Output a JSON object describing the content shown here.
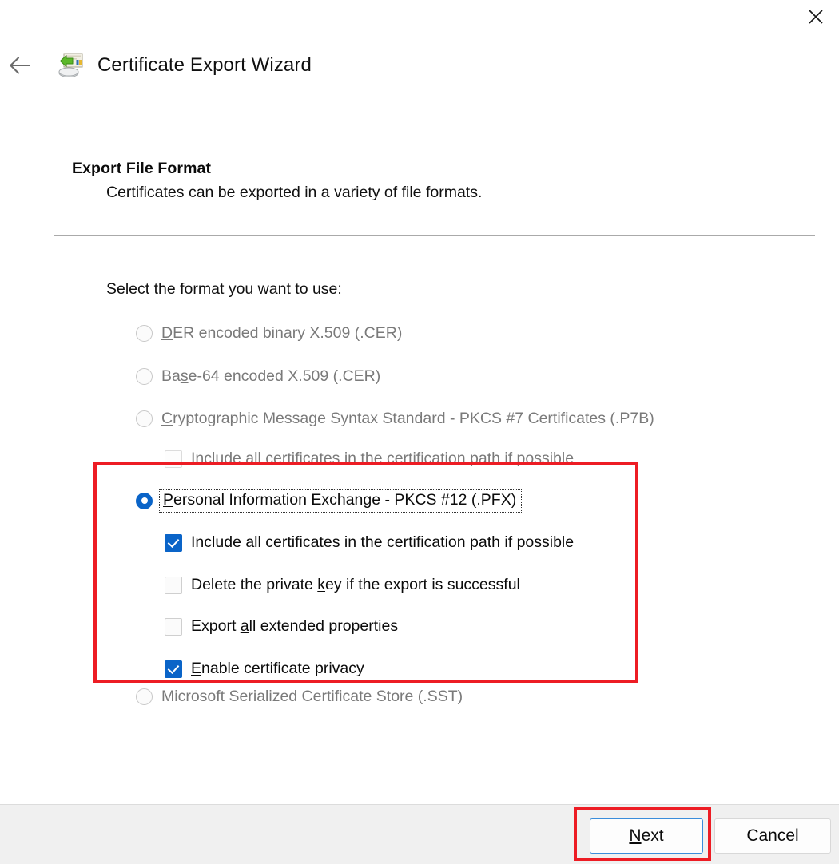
{
  "window": {
    "title": "Certificate Export Wizard",
    "close_label": "✕",
    "back_label": "←",
    "icon_name": "certificate-export-icon"
  },
  "page": {
    "heading": "Export File Format",
    "subheading": "Certificates can be exported in a variety of file formats.",
    "prompt": "Select the format you want to use:"
  },
  "options": [
    {
      "id": "der",
      "control": "radio",
      "label_pre": "D",
      "label_accel": "E",
      "label_post": "R encoded binary X.509 (.CER)",
      "full_label": "DER encoded binary X.509 (.CER)",
      "checked": false,
      "enabled": false
    },
    {
      "id": "base64",
      "control": "radio",
      "label_pre": "Ba",
      "label_accel": "s",
      "label_post": "e-64 encoded X.509 (.CER)",
      "full_label": "Base-64 encoded X.509 (.CER)",
      "checked": false,
      "enabled": false
    },
    {
      "id": "p7b",
      "control": "radio",
      "label_pre": "",
      "label_accel": "C",
      "label_post": "ryptographic Message Syntax Standard - PKCS #7 Certificates (.P7B)",
      "full_label": "Cryptographic Message Syntax Standard - PKCS #7 Certificates (.P7B)",
      "checked": false,
      "enabled": false
    },
    {
      "id": "p7b-include-all",
      "control": "checkbox",
      "label_pre": "",
      "label_accel": "",
      "label_post": "Include all certificates in the certification path if possible",
      "full_label": "Include all certificates in the certification path if possible",
      "checked": false,
      "enabled": false
    },
    {
      "id": "pfx",
      "control": "radio",
      "label_pre": "",
      "label_accel": "P",
      "label_post": "ersonal Information Exchange - PKCS #12 (.PFX)",
      "full_label": "Personal Information Exchange - PKCS #12 (.PFX)",
      "checked": true,
      "enabled": true,
      "focused": true
    },
    {
      "id": "pfx-include-all",
      "control": "checkbox",
      "label_pre": "Incl",
      "label_accel": "u",
      "label_post": "de all certificates in the certification path if possible",
      "full_label": "Include all certificates in the certification path if possible",
      "checked": true,
      "enabled": true
    },
    {
      "id": "pfx-delete-key",
      "control": "checkbox",
      "label_pre": "Delete the private ",
      "label_accel": "k",
      "label_post": "ey if the export is successful",
      "full_label": "Delete the private key if the export is successful",
      "checked": false,
      "enabled": true
    },
    {
      "id": "pfx-export-ext",
      "control": "checkbox",
      "label_pre": "Export ",
      "label_accel": "a",
      "label_post": "ll extended properties",
      "full_label": "Export all extended properties",
      "checked": false,
      "enabled": true
    },
    {
      "id": "pfx-enable-privacy",
      "control": "checkbox",
      "label_pre": "",
      "label_accel": "E",
      "label_post": "nable certificate privacy",
      "full_label": "Enable certificate privacy",
      "checked": true,
      "enabled": true
    },
    {
      "id": "sst",
      "control": "radio",
      "label_pre": "Microsoft Serialized Certificate S",
      "label_accel": "t",
      "label_post": "ore (.SST)",
      "full_label": "Microsoft Serialized Certificate Store (.SST)",
      "checked": false,
      "enabled": false
    }
  ],
  "footer": {
    "next_pre": "",
    "next_accel": "N",
    "next_post": "ext",
    "next_label": "Next",
    "cancel_label": "Cancel"
  },
  "colors": {
    "accent_blue": "#0a64c8",
    "annotation_red": "#ed1c24",
    "default_button_border": "#3a8ddb",
    "footer_bg": "#f0f0f0",
    "disabled_text": "#7a7a7a"
  }
}
